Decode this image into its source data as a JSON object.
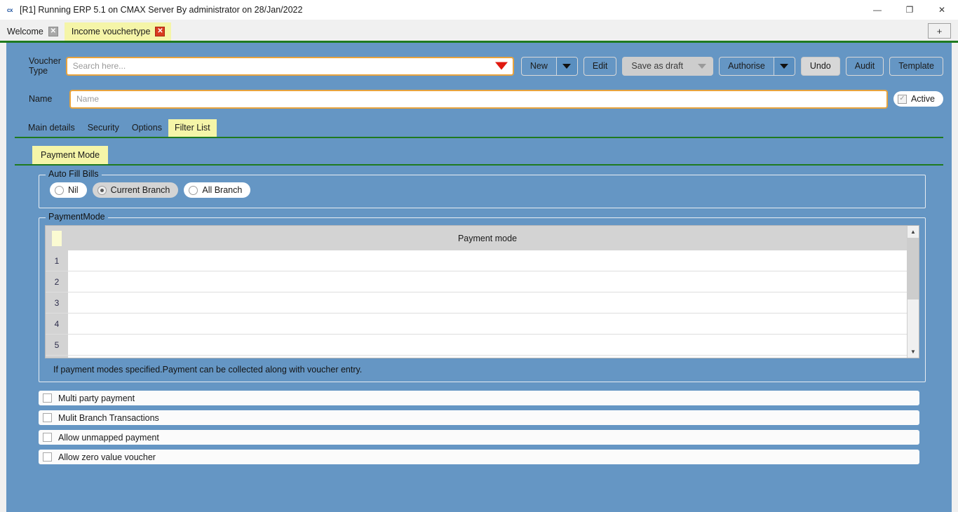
{
  "window": {
    "title": "[R1] Running ERP 5.1 on CMAX Server By administrator on 28/Jan/2022",
    "app_icon_text": "cx",
    "minimize": "—",
    "maximize": "❐",
    "close": "✕"
  },
  "tabstrip": {
    "tabs": [
      {
        "label": "Welcome",
        "close": "✕",
        "active": false
      },
      {
        "label": "Income vouchertype",
        "close": "✕",
        "active": true
      }
    ],
    "new_tab": "+"
  },
  "form": {
    "voucher_type_label": "Voucher Type",
    "voucher_type_value": "",
    "voucher_type_placeholder": "Search here...",
    "name_label": "Name",
    "name_value": "",
    "name_placeholder": "Name",
    "active_label": "Active",
    "active_checked": true
  },
  "toolbar": {
    "new_label": "New",
    "edit_label": "Edit",
    "save_as_draft_label": "Save as draft",
    "authorise_label": "Authorise",
    "undo_label": "Undo",
    "audit_label": "Audit",
    "template_label": "Template"
  },
  "tabs": {
    "primary": [
      {
        "label": "Main details",
        "active": false
      },
      {
        "label": "Security",
        "active": false
      },
      {
        "label": "Options",
        "active": false
      },
      {
        "label": "Filter List",
        "active": true
      }
    ],
    "secondary": [
      {
        "label": "Payment Mode",
        "active": true
      }
    ]
  },
  "auto_fill_bills": {
    "legend": "Auto Fill Bills",
    "options": [
      {
        "label": "Nil",
        "selected": false
      },
      {
        "label": "Current Branch",
        "selected": true
      },
      {
        "label": "All Branch",
        "selected": false
      }
    ]
  },
  "payment_mode": {
    "legend": "PaymentMode",
    "column_header": "Payment mode",
    "rows": [
      {
        "num": "1",
        "value": ""
      },
      {
        "num": "2",
        "value": ""
      },
      {
        "num": "3",
        "value": ""
      },
      {
        "num": "4",
        "value": ""
      },
      {
        "num": "5",
        "value": ""
      }
    ],
    "hint": "If payment modes specified.Payment can be collected along with voucher entry.",
    "scroll_up": "▲",
    "scroll_down": "▼"
  },
  "checkboxes": [
    {
      "label": "Multi party payment",
      "checked": false
    },
    {
      "label": "Mulit Branch Transactions",
      "checked": false
    },
    {
      "label": "Allow unmapped payment",
      "checked": false
    },
    {
      "label": "Allow zero value voucher",
      "checked": false
    }
  ],
  "colors": {
    "panel_blue": "#6596c4",
    "tab_yellow": "#f5f5a8",
    "tab_underline_green": "#1f7a1f",
    "input_border_gold": "#e8a33d",
    "caret_red": "#e0190f",
    "close_red": "#d93a1f"
  }
}
